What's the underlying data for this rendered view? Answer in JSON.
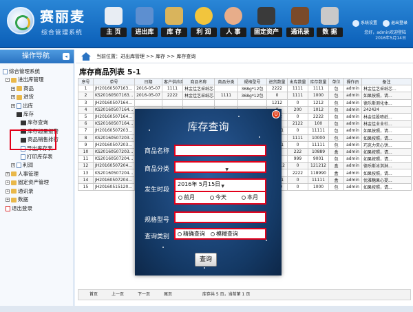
{
  "brand": {
    "title": "赛丽麦",
    "subtitle": "综合管理系统"
  },
  "nav": [
    {
      "label": "主  页",
      "icon": "home-icon",
      "color": "#e8edf3"
    },
    {
      "label": "进出库",
      "icon": "cart-icon",
      "color": "#5d8fd0"
    },
    {
      "label": "库 存",
      "icon": "inventory-icon",
      "color": "#d9b45c"
    },
    {
      "label": "利 润",
      "icon": "profit-icon",
      "color": "#f2c53d"
    },
    {
      "label": "人 事",
      "icon": "people-icon",
      "color": "#e7ad8a"
    },
    {
      "label": "固定资产",
      "icon": "asset-icon",
      "color": "#3a3a3a"
    },
    {
      "label": "通讯录",
      "icon": "contacts-icon",
      "color": "#7a4a2a"
    },
    {
      "label": "数 据",
      "icon": "data-icon",
      "color": "#c9c9c9"
    }
  ],
  "top_links": {
    "settings": "系统设置",
    "logout": "退出登录"
  },
  "welcome": {
    "line1": "您好，admin欢迎登陆",
    "line2": "2016年5月14日"
  },
  "sidebar": {
    "title": "操作导航",
    "items": [
      "综合管理系统",
      "进出库管理",
      "商品",
      "进货",
      "出库",
      "库存",
      "库存查询",
      "库存超量报警",
      "商品销售排行",
      "导出库存表",
      "打印库存表",
      "利润",
      "人事管理",
      "固定资产管理",
      "通讯录",
      "数据",
      "退出登录"
    ]
  },
  "breadcrumb": "当前位置：进出库管理 >> 库存 >> 库存查询",
  "page_title": "库存商品列表 5-1",
  "table": {
    "headers": [
      "序号",
      "单号",
      "日期",
      "客户供应商",
      "商品名称",
      "商品分类",
      "规格型号",
      "进货数量",
      "出库数量",
      "库存数量",
      "单位",
      "操作员",
      "备注"
    ],
    "rows": [
      [
        "1",
        "JH20160507163...",
        "2016-05-07",
        "1111",
        "林金佳艺采纸芯...",
        "",
        "368g*12包",
        "2222",
        "1111",
        "1111",
        "包",
        "admin",
        "林金佳艺采纸芯..."
      ],
      [
        "2",
        "KS20160507163...",
        "2016-05-07",
        "2222",
        "林金佳艺采纸芯...",
        "1111",
        "368g*12包",
        "0",
        "1111",
        "1000",
        "包",
        "admin",
        "如果按照，请..."
      ],
      [
        "3",
        "JH20160507164...",
        "",
        "",
        "",
        "",
        "",
        "1212",
        "0",
        "1212",
        "包",
        "admin",
        "德乐斯测化体..."
      ],
      [
        "4",
        "KS20160507164...",
        "",
        "",
        "",
        "",
        "",
        "0",
        "200",
        "1012",
        "包",
        "admin",
        "242424"
      ],
      [
        "5",
        "JH20160507164...",
        "",
        "",
        "",
        "",
        "",
        "2222",
        "0",
        "2222",
        "包",
        "admin",
        "林金佳股喷纸..."
      ],
      [
        "6",
        "KS20160507164...",
        "",
        "",
        "",
        "",
        "",
        "0",
        "2122",
        "100",
        "包",
        "admin",
        "林金佳业业社..."
      ],
      [
        "7",
        "JH20160507203...",
        "",
        "",
        "",
        "",
        "",
        "11111",
        "0",
        "11111",
        "包",
        "admin",
        "如果按照，请..."
      ],
      [
        "8",
        "KS20160507203...",
        "",
        "",
        "",
        "",
        "",
        "0",
        "1111",
        "10000",
        "包",
        "admin",
        "如果按照，请..."
      ],
      [
        "9",
        "JH20160507203...",
        "",
        "",
        "",
        "",
        "",
        "11111",
        "0",
        "11111",
        "包",
        "admin",
        "巧克力夹心饼..."
      ],
      [
        "10",
        "KS20160507203...",
        "",
        "",
        "",
        "",
        "",
        "0",
        "222",
        "10889",
        "盒",
        "admin",
        "如果按照，请..."
      ],
      [
        "11",
        "KS20160507204...",
        "",
        "",
        "",
        "",
        "",
        "0",
        "999",
        "9001",
        "包",
        "admin",
        "如果按照，请..."
      ],
      [
        "12",
        "JH20160507204...",
        "",
        "",
        "",
        "",
        "",
        "121212",
        "0",
        "121212",
        "盒",
        "admin",
        "德乐斯冰淇淋..."
      ],
      [
        "13",
        "KS20160507204...",
        "",
        "",
        "",
        "",
        "",
        "0",
        "2222",
        "118990",
        "盒",
        "admin",
        "如果按照，请..."
      ],
      [
        "14",
        "JH20160507204...",
        "",
        "",
        "",
        "",
        "",
        "11111",
        "0",
        "11111",
        "盒",
        "admin",
        "优雅糖果心提..."
      ],
      [
        "15",
        "JH20160515120...",
        "",
        "",
        "",
        "",
        "",
        "1000",
        "0",
        "1000",
        "包",
        "admin",
        "如果按照，请..."
      ]
    ]
  },
  "pager": {
    "first": "首页",
    "prev": "上一页",
    "next": "下一页",
    "last": "尾页",
    "info": "库存共 5 页，当前第 1 页"
  },
  "modal": {
    "title": "库存查询",
    "close": "0",
    "name_label": "商品名称",
    "category_label": "商品分类",
    "date_label": "发生时段",
    "date_value": "2016年  5月15日",
    "period_options": [
      "前月",
      "今天",
      "本月"
    ],
    "spec_label": "规格型号",
    "type_label": "查询类别",
    "type_options": [
      "精确查询",
      "模糊查询"
    ],
    "query_button": "查询"
  }
}
